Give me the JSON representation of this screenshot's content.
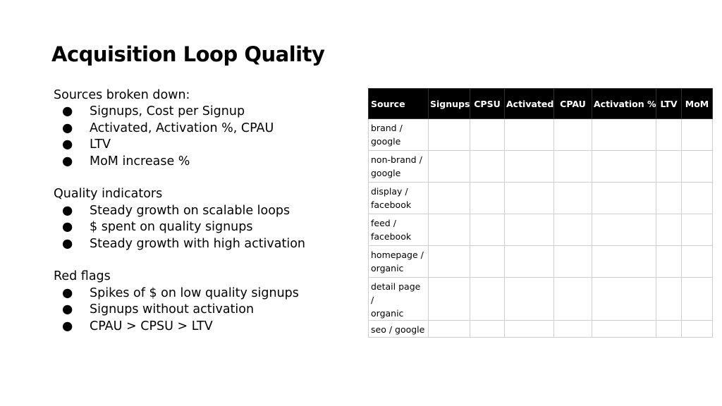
{
  "title": "Acquisition Loop Quality",
  "groups": [
    {
      "heading": "Sources broken down:",
      "bullets": [
        "Signups, Cost per Signup",
        "Activated, Activation %, CPAU",
        "LTV",
        "MoM increase %"
      ]
    },
    {
      "heading": "Quality indicators",
      "bullets": [
        "Steady growth on scalable loops",
        "$ spent on quality signups",
        "Steady growth with high activation"
      ]
    },
    {
      "heading": "Red flags",
      "bullets": [
        "Spikes of $ on low quality signups",
        "Signups without activation",
        "CPAU > CPSU > LTV"
      ]
    }
  ],
  "bullet_glyph": "●",
  "table": {
    "columns": [
      "Source",
      "Signups",
      "CPSU",
      "Activated",
      "CPAU",
      "Activation %",
      "LTV",
      "MoM"
    ],
    "rows": [
      [
        "brand /",
        "google"
      ],
      [
        "non-brand /",
        "google"
      ],
      [
        "display /",
        "facebook"
      ],
      [
        "feed /",
        "facebook"
      ],
      [
        "homepage /",
        "organic"
      ],
      [
        "detail page /",
        "organic"
      ],
      [
        "seo / google"
      ]
    ]
  }
}
